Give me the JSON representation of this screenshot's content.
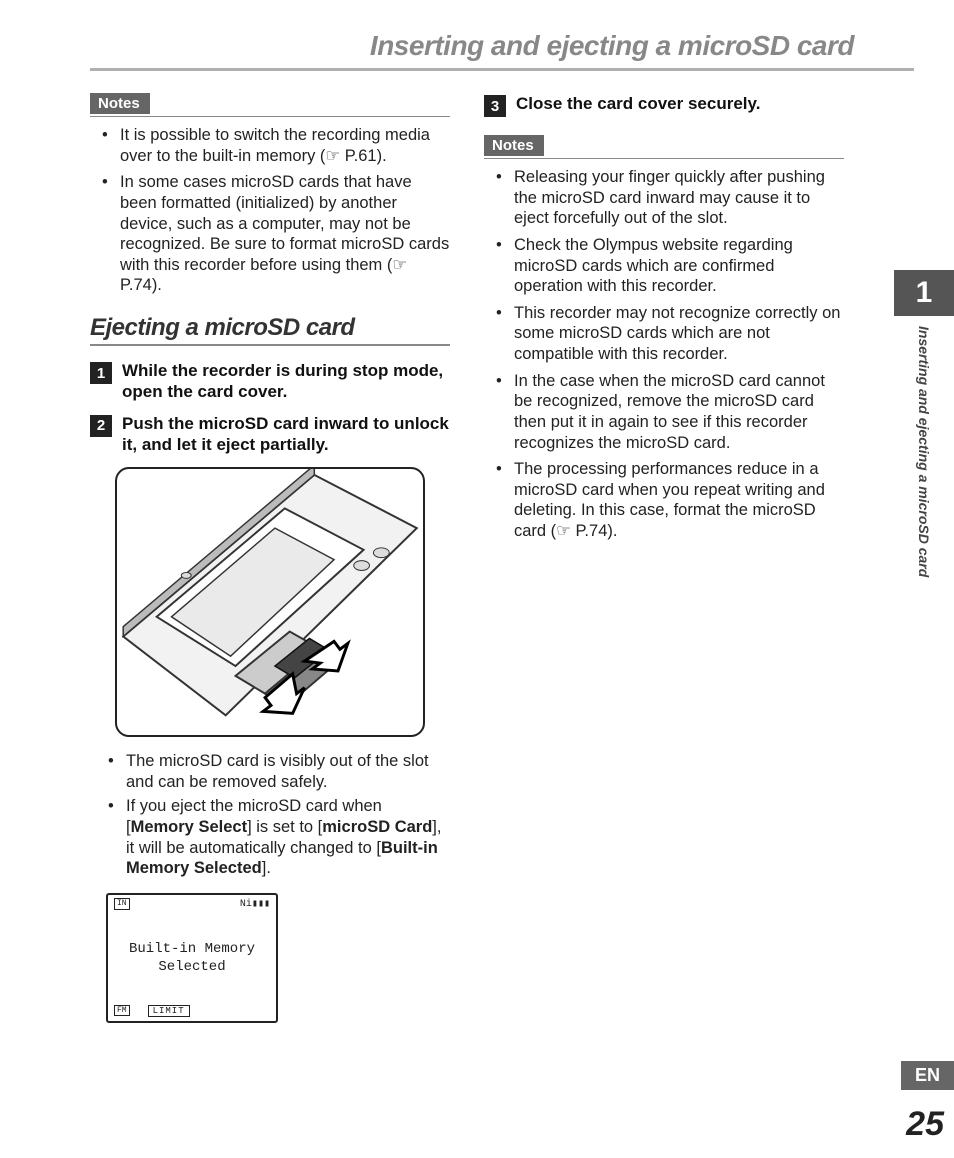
{
  "header": {
    "title": "Inserting and ejecting a microSD card"
  },
  "left": {
    "notes_label": "Notes",
    "notes_items": [
      "It is possible to switch the recording media over to the built-in memory (☞ P.61).",
      "In some cases microSD cards that have been formatted (initialized) by another device, such as a computer, may not be recognized. Be sure to format microSD cards with this recorder before using them (☞ P.74)."
    ],
    "section_heading": "Ejecting a microSD card",
    "step1_num": "1",
    "step1_text": "While the recorder is during stop mode, open the card cover.",
    "step2_num": "2",
    "step2_text": "Push the microSD card inward to unlock it, and let it eject partially.",
    "sub_item1": "The microSD card is visibly out of the slot and can be removed safely.",
    "sub_item2_pre": "If you eject the microSD card when [",
    "sub_item2_b1": "Memory Select",
    "sub_item2_mid1": "] is set to [",
    "sub_item2_b2": "microSD Card",
    "sub_item2_mid2": "], it will be automatically changed to [",
    "sub_item2_b3": "Built-in Memory Selected",
    "sub_item2_end": "].",
    "lcd_line1": "Built-in Memory",
    "lcd_line2": "Selected",
    "lcd_limit": "LIMIT",
    "lcd_tl": "IN",
    "lcd_bl": "FM"
  },
  "right": {
    "step3_num": "3",
    "step3_text": "Close the card cover securely.",
    "notes_label": "Notes",
    "notes_items": [
      "Releasing your finger quickly after pushing the microSD card inward may cause it to eject forcefully out of the slot.",
      "Check the Olympus website regarding microSD cards which are confirmed operation with this recorder.",
      "This recorder may not recognize correctly on some microSD cards which are not compatible with this recorder.",
      "In the case when the microSD card cannot be recognized, remove the microSD card then put it in again to see if this recorder recognizes the microSD card.",
      "The processing performances reduce in a microSD card when you repeat writing and deleting. In this case, format the microSD card (☞ P.74)."
    ]
  },
  "side": {
    "chapter_num": "1",
    "vertical_label": "Inserting and ejecting a microSD card",
    "lang": "EN",
    "page": "25"
  }
}
